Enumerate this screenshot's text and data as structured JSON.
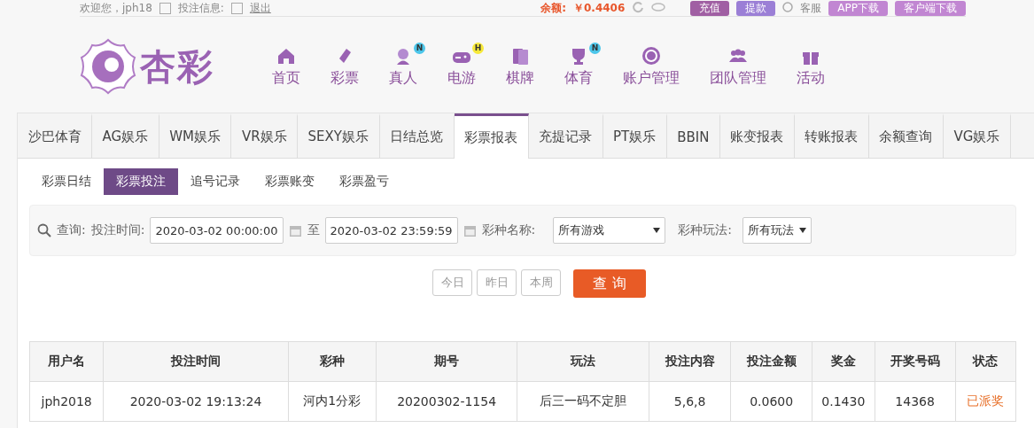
{
  "top_bar": {
    "welcome": "欢迎您，jph18",
    "message_label": "投注信息:",
    "logout": "退出",
    "balance_label": "余额:",
    "balance": "￥0.4406",
    "buttons": [
      {
        "label": "充值",
        "kind": "deposit"
      },
      {
        "label": "提款",
        "kind": "withdraw"
      }
    ],
    "service": "客服",
    "downloads": [
      "APP下载",
      "客户端下载"
    ]
  },
  "logo": {
    "text": "杏彩"
  },
  "nav": [
    {
      "label": "首页"
    },
    {
      "label": "彩票"
    },
    {
      "label": "真人",
      "badge": "N"
    },
    {
      "label": "电游",
      "badge": "H"
    },
    {
      "label": "棋牌"
    },
    {
      "label": "体育",
      "badge": "N"
    },
    {
      "label": "账户管理"
    },
    {
      "label": "团队管理"
    },
    {
      "label": "活动"
    }
  ],
  "tabs": [
    {
      "label": "沙巴体育",
      "selected": false
    },
    {
      "label": "AG娱乐",
      "selected": false
    },
    {
      "label": "WM娱乐",
      "selected": false
    },
    {
      "label": "VR娱乐",
      "selected": false
    },
    {
      "label": "SEXY娱乐",
      "selected": false
    },
    {
      "label": "日结总览",
      "selected": false
    },
    {
      "label": "彩票报表",
      "selected": true
    },
    {
      "label": "充提记录",
      "selected": false
    },
    {
      "label": "PT娱乐",
      "selected": false
    },
    {
      "label": "BBIN",
      "selected": false
    },
    {
      "label": "账变报表",
      "selected": false
    },
    {
      "label": "转账报表",
      "selected": false
    },
    {
      "label": "余额查询",
      "selected": false
    },
    {
      "label": "VG娱乐",
      "selected": false
    }
  ],
  "subtabs": [
    {
      "label": "彩票日结",
      "selected": false
    },
    {
      "label": "彩票投注",
      "selected": true
    },
    {
      "label": "追号记录",
      "selected": false
    },
    {
      "label": "彩票账变",
      "selected": false
    },
    {
      "label": "彩票盈亏",
      "selected": false
    }
  ],
  "query": {
    "label": "查询:",
    "time_label": "投注时间:",
    "start": "2020-03-02 00:00:00",
    "to": "至",
    "end": "2020-03-02 23:59:59",
    "game_label": "彩种名称:",
    "game": "所有游戏",
    "play_label": "彩种玩法:",
    "play": "所有玩法"
  },
  "quick_buttons": [
    "今日",
    "昨日",
    "本周"
  ],
  "search_button": "查 询",
  "table": {
    "columns": [
      "用户名",
      "投注时间",
      "彩种",
      "期号",
      "玩法",
      "投注内容",
      "投注金额",
      "奖金",
      "开奖号码",
      "状态"
    ],
    "rows": [
      {
        "cells": [
          "jph2018",
          "2020-03-02 19:13:24",
          "河内1分彩",
          "20200302-1154",
          "后三一码不定胆",
          "5,6,8",
          "0.0600",
          "0.1430",
          "14368",
          "已派奖"
        ]
      }
    ]
  }
}
